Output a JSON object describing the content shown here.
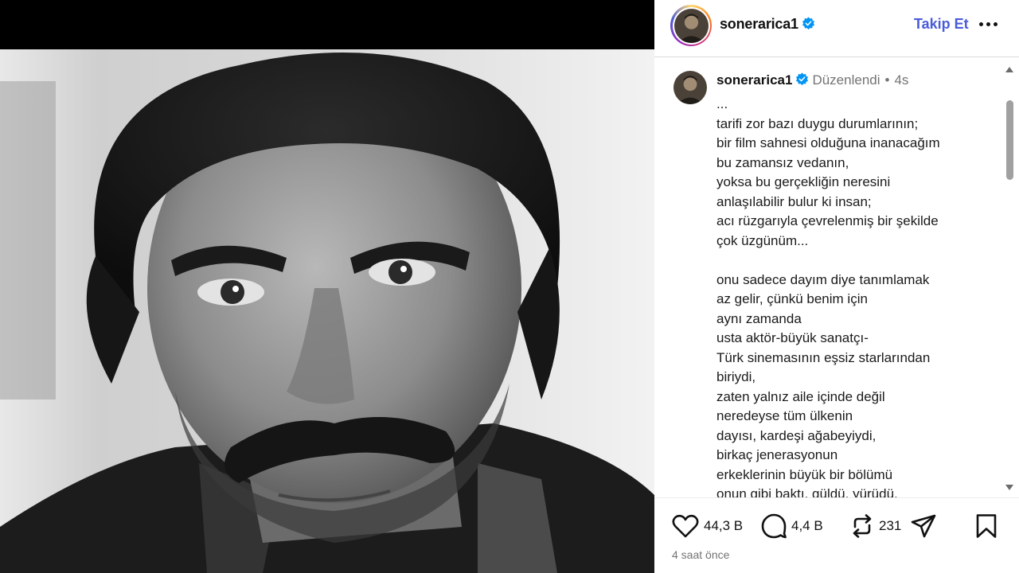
{
  "post": {
    "username": "sonerarica1",
    "verified": true,
    "follow_label": "Takip Et",
    "more_label": "•••",
    "edited_label": "Düzenlendi",
    "separator": "•",
    "relative_time": "4s",
    "caption": "...\ntarifi zor bazı duygu durumlarının;\nbir film sahnesi olduğuna inanacağım\nbu zamansız vedanın,\nyoksa bu gerçekliğin neresini\nanlaşılabilir bulur ki insan;\nacı rüzgarıyla çevrelenmiş bir şekilde\nçok üzgünüm...\n\nonu sadece dayım diye tanımlamak\naz gelir, çünkü benim için\naynı zamanda\nusta aktör-büyük sanatçı-\nTürk sinemasının eşsiz starlarından\nbiriydi,\nzaten yalnız aile içinde değil\nneredeyse tüm ülkenin\ndayısı, kardeşi ağabeyiydi,\nbirkaç jenerasyonun\nerkeklerinin büyük bir bölümü\nonun gibi baktı, güldü, yürüdü,",
    "likes": "44,3 B",
    "comments": "4,4 B",
    "reposts": "231",
    "posted_ago": "4 saat önce"
  },
  "icons": {
    "like": "heart-icon",
    "comment": "comment-icon",
    "repost": "repost-icon",
    "share": "send-icon",
    "save": "bookmark-icon",
    "verified": "verified-badge-icon"
  },
  "colors": {
    "link_blue": "#4a5bd9",
    "verified_blue": "#0095f6",
    "muted_text": "#737373",
    "divider": "#dbdbdb"
  }
}
